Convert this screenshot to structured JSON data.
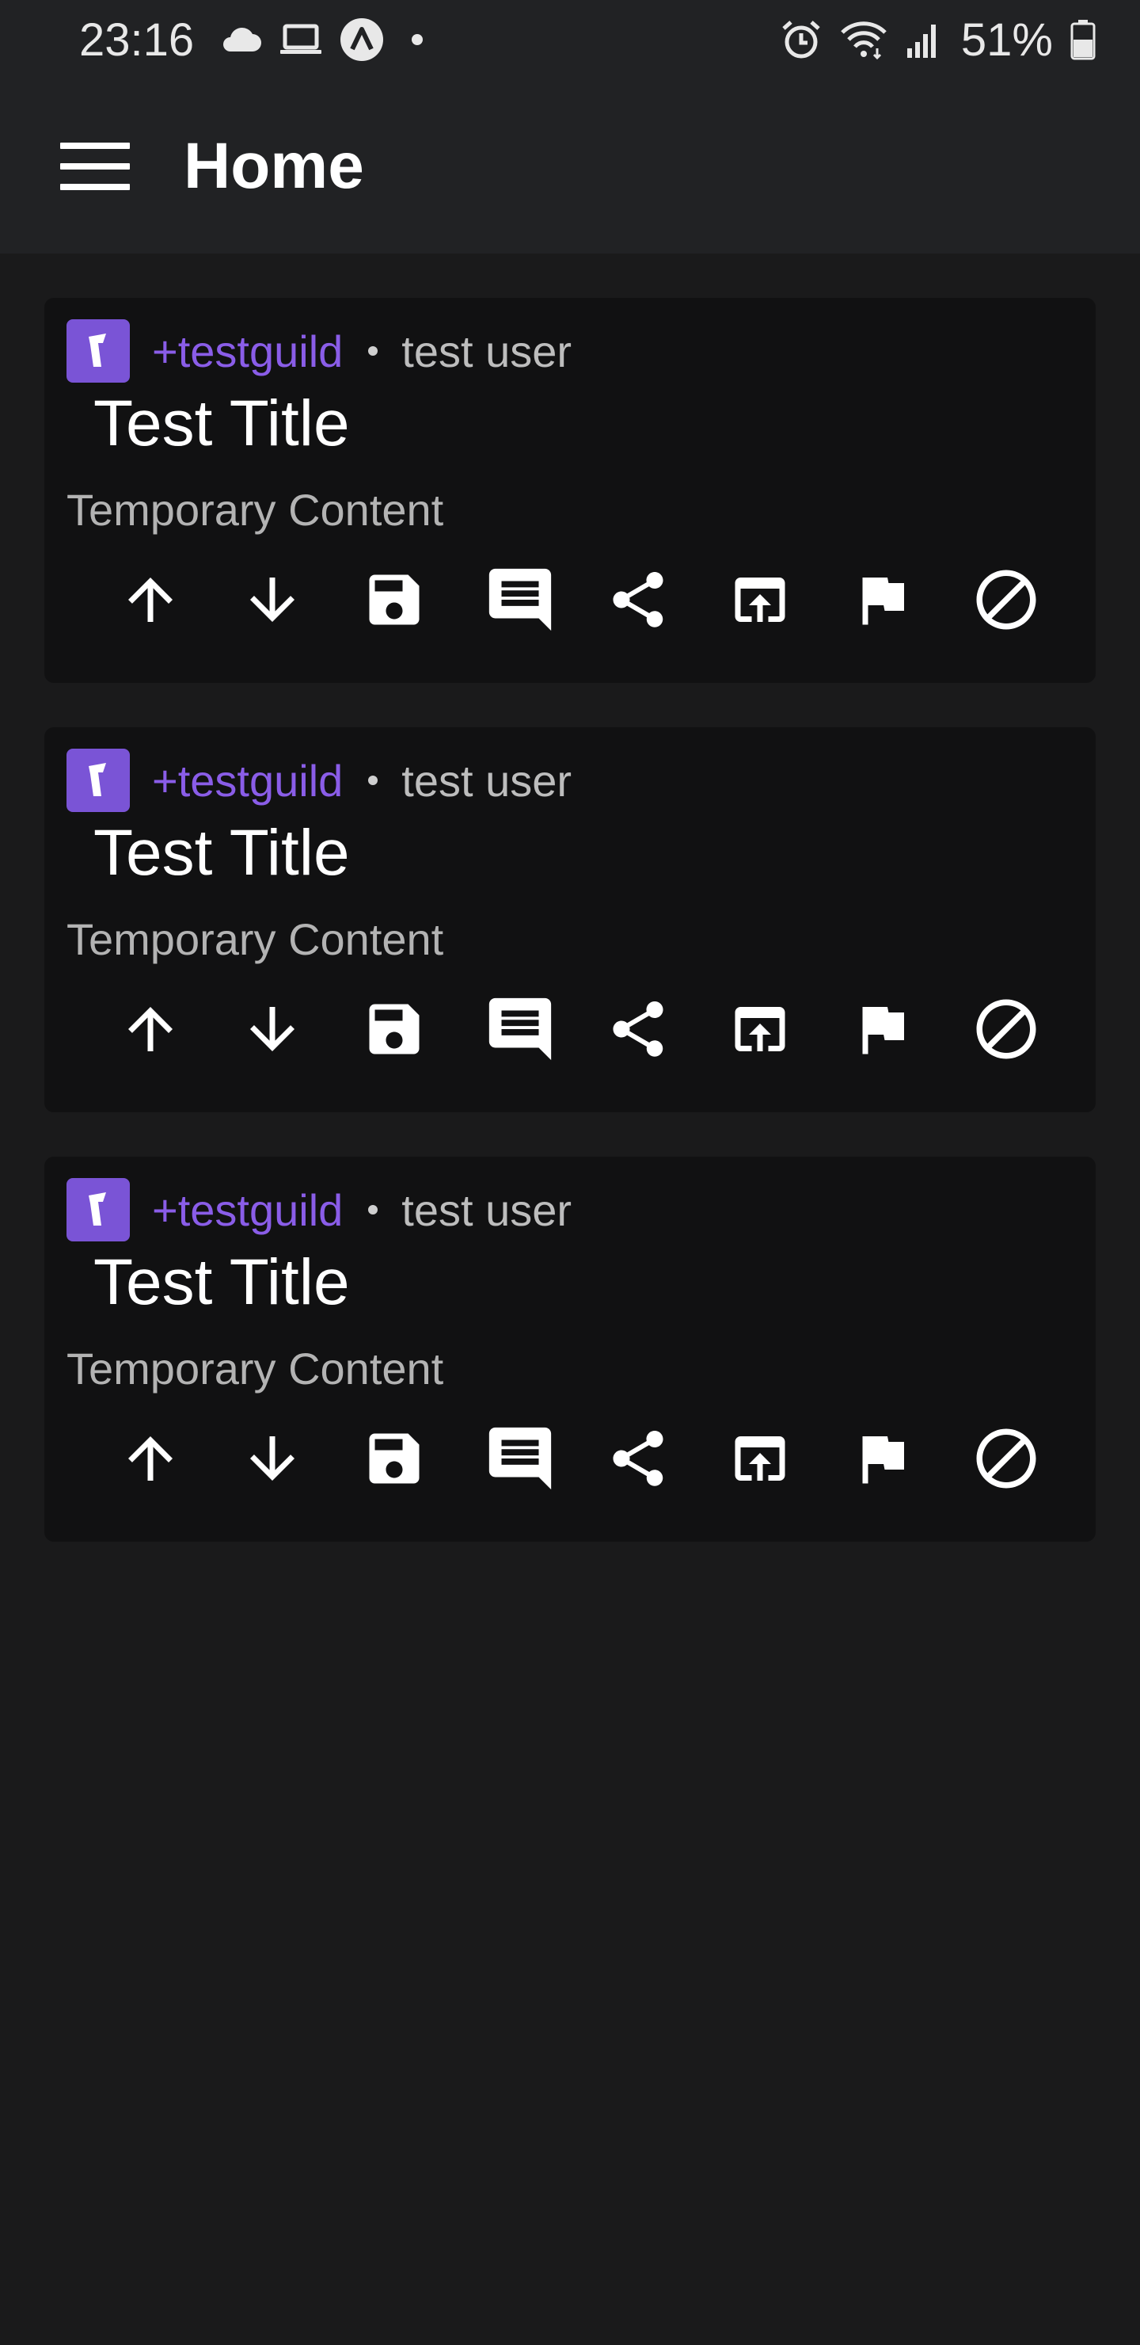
{
  "status_bar": {
    "time": "23:16",
    "battery_percent": "51%",
    "left_icons": [
      "cloud-icon",
      "laptop-icon",
      "app-notification-icon",
      "more-notifications-dot-icon"
    ],
    "right_icons": [
      "alarm-icon",
      "wifi-icon",
      "signal-icon",
      "battery-icon"
    ]
  },
  "app_bar": {
    "title": "Home",
    "menu_icon": "hamburger-menu-icon"
  },
  "colors": {
    "background": "#1a1a1b",
    "bar_background": "#212224",
    "card_background": "#111112",
    "accent": "#8a5de8",
    "guild_icon_background": "#7a54d6",
    "muted_text": "#b3b3b3"
  },
  "posts": [
    {
      "guild": "+testguild",
      "author": "test user",
      "title": "Test Title",
      "content": "Temporary Content"
    },
    {
      "guild": "+testguild",
      "author": "test user",
      "title": "Test Title",
      "content": "Temporary Content"
    },
    {
      "guild": "+testguild",
      "author": "test user",
      "title": "Test Title",
      "content": "Temporary Content"
    }
  ],
  "post_actions": [
    "upvote-icon",
    "downvote-icon",
    "save-icon",
    "comment-icon",
    "share-icon",
    "open-external-icon",
    "report-flag-icon",
    "block-icon"
  ]
}
